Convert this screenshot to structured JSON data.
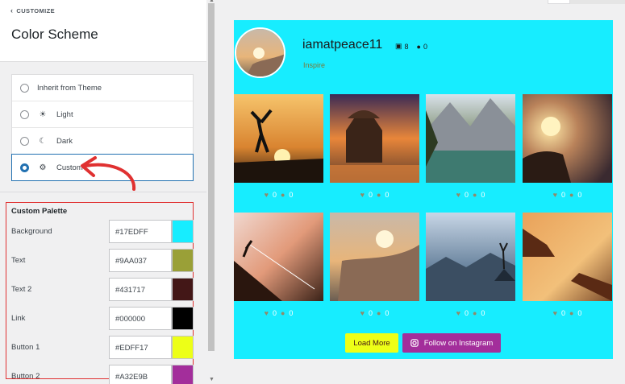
{
  "panel": {
    "back_label": "CUSTOMIZE",
    "title": "Color Scheme",
    "options": [
      {
        "label": "Inherit from Theme",
        "icon": "",
        "selected": false
      },
      {
        "label": "Light",
        "icon": "sun-icon",
        "selected": false
      },
      {
        "label": "Dark",
        "icon": "moon-icon",
        "selected": false
      },
      {
        "label": "Custom",
        "icon": "gear-icon",
        "selected": true
      }
    ],
    "palette": {
      "title": "Custom Palette",
      "rows": [
        {
          "label": "Background",
          "value": "#17EDFF",
          "color": "#17EDFF"
        },
        {
          "label": "Text",
          "value": "#9AA037",
          "color": "#9AA037"
        },
        {
          "label": "Text 2",
          "value": "#431717",
          "color": "#431717"
        },
        {
          "label": "Link",
          "value": "#000000",
          "color": "#000000"
        },
        {
          "label": "Button 1",
          "value": "#EDFF17",
          "color": "#EDFF17"
        },
        {
          "label": "Button 2",
          "value": "#A32E9B",
          "color": "#A32E9B"
        }
      ]
    }
  },
  "feed": {
    "username": "iamatpeace11",
    "photo_count": "8",
    "follower_count": "0",
    "bio": "Inspire",
    "posts": [
      {
        "likes": "0",
        "comments": "0"
      },
      {
        "likes": "0",
        "comments": "0"
      },
      {
        "likes": "0",
        "comments": "0"
      },
      {
        "likes": "0",
        "comments": "0"
      },
      {
        "likes": "0",
        "comments": "0"
      },
      {
        "likes": "0",
        "comments": "0"
      },
      {
        "likes": "0",
        "comments": "0"
      },
      {
        "likes": "0",
        "comments": "0"
      }
    ],
    "load_more_label": "Load More",
    "follow_label": "Follow on Instagram"
  },
  "colors": {
    "accent": "#2271b1",
    "highlight": "#e03131",
    "feed_background": "#17EDFF"
  }
}
